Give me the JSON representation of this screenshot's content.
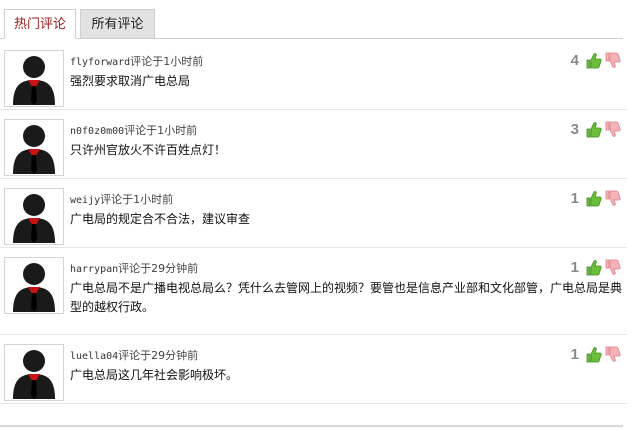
{
  "tabs": {
    "hot": "热门评论",
    "all": "所有评论"
  },
  "comments": [
    {
      "user": "flyforward",
      "time": "评论于1小时前",
      "text": "强烈要求取消广电总局",
      "votes": "4"
    },
    {
      "user": "n0f0z0m00",
      "time": "评论于1小时前",
      "text": "只许州官放火不许百姓点灯！",
      "votes": "3"
    },
    {
      "user": "weijy",
      "time": "评论于1小时前",
      "text": "广电局的规定合不合法，建议审查",
      "votes": "1"
    },
    {
      "user": "harrypan",
      "time": "评论于29分钟前",
      "text": "广电总局不是广播电视总局么？凭什么去管网上的视频？要管也是信息产业部和文化部管，广电总局是典型的越权行政。",
      "votes": "1"
    },
    {
      "user": "luella04",
      "time": "评论于29分钟前",
      "text": "广电总局这几年社会影响极坏。",
      "votes": "1"
    }
  ],
  "icons": {
    "avatar": "default-user-avatar-icon",
    "up": "thumbs-up-icon",
    "down": "thumbs-down-icon"
  },
  "colors": {
    "active_tab_text": "#9b1c1c",
    "inactive_tab_bg": "#e2e2e2",
    "vote_count": "#8a8a8a",
    "up": "#6bbf3a",
    "down": "#f2a3a8"
  }
}
